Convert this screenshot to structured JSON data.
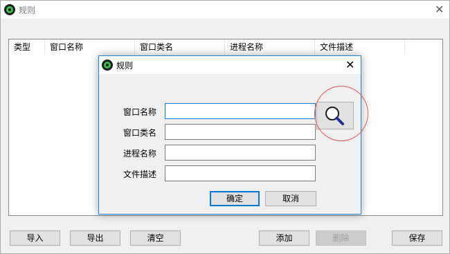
{
  "main_window": {
    "title": "规则",
    "columns": [
      "类型",
      "窗口名称",
      "窗口类名",
      "进程名称",
      "文件描述"
    ],
    "buttons": {
      "import": "导入",
      "export": "导出",
      "clear": "清空",
      "add": "添加",
      "delete": "删除",
      "save": "保存"
    }
  },
  "dialog": {
    "title": "规则",
    "fields": {
      "window_name": {
        "label": "窗口名称",
        "value": ""
      },
      "window_class": {
        "label": "窗口类名",
        "value": ""
      },
      "process_name": {
        "label": "进程名称",
        "value": ""
      },
      "file_description": {
        "label": "文件描述",
        "value": ""
      }
    },
    "ok_label": "确定",
    "cancel_label": "取消"
  },
  "colors": {
    "accent": "#0078d7",
    "highlight_ring": "#e05050",
    "icon_green": "#3cc04a"
  },
  "icons": {
    "app": "green-circle-app-icon",
    "finder": "magnifier-icon",
    "close": "close-icon"
  }
}
